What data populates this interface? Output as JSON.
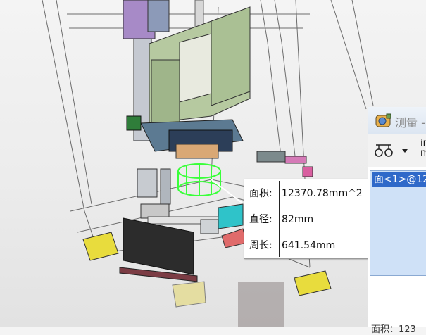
{
  "callout": {
    "rows": [
      {
        "label": "面积:",
        "value": "12370.78mm^2"
      },
      {
        "label": "直径:",
        "value": "82mm"
      },
      {
        "label": "周长:",
        "value": "641.54mm"
      }
    ]
  },
  "measure_panel": {
    "title": "测量 -",
    "toolbar_label": "in\nm",
    "results": [
      {
        "text": "面<1>@12"
      }
    ],
    "bottom_text": "面积：123"
  },
  "colors": {
    "selection_blue": "#2f69c9",
    "highlight_green": "#39ff39",
    "results_bg": "#cfe1f7"
  }
}
